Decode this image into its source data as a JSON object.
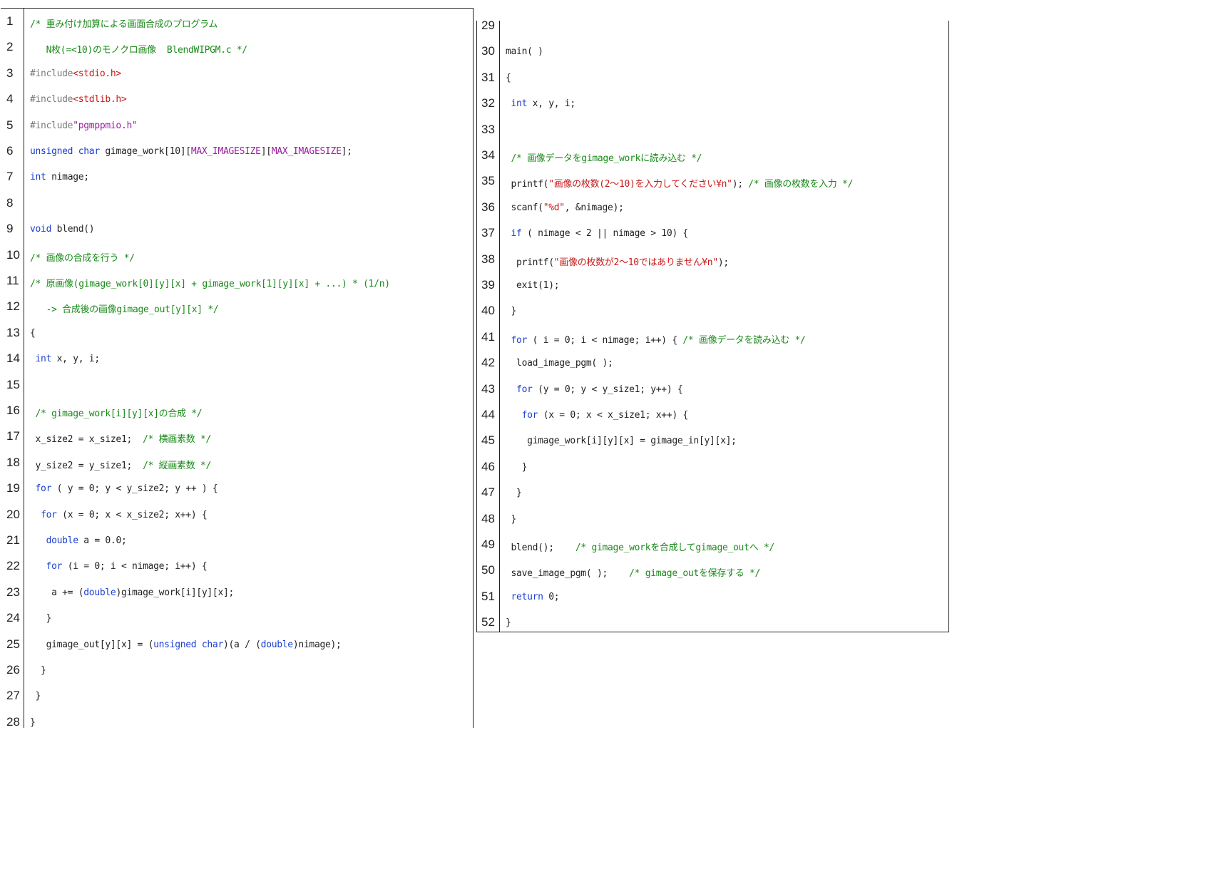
{
  "colors": {
    "keyword": "#1a3fd0",
    "comment": "#1a8a1a",
    "string": "#c81a1a",
    "macro": "#9a1ea0",
    "preprocessor": "#7a7a7a",
    "plain": "#222222"
  },
  "left_lines": [
    {
      "n": "1",
      "tokens": [
        {
          "t": "cm",
          "v": "/* 重み付け加算による画面合成のプログラム"
        }
      ]
    },
    {
      "n": "2",
      "tokens": [
        {
          "t": "cm",
          "v": "   N枚(=<10)のモノクロ画像  BlendWIPGM.c */"
        }
      ]
    },
    {
      "n": "3",
      "tokens": [
        {
          "t": "pp",
          "v": "#include"
        },
        {
          "t": "str",
          "v": "<stdio.h>"
        }
      ]
    },
    {
      "n": "4",
      "tokens": [
        {
          "t": "pp",
          "v": "#include"
        },
        {
          "t": "str",
          "v": "<stdlib.h>"
        }
      ]
    },
    {
      "n": "5",
      "tokens": [
        {
          "t": "pp",
          "v": "#include"
        },
        {
          "t": "mac",
          "v": "\"pgmppmio.h\""
        }
      ]
    },
    {
      "n": "6",
      "tokens": [
        {
          "t": "kw",
          "v": "unsigned char"
        },
        {
          "t": "pl",
          "v": " gimage_work[10]["
        },
        {
          "t": "mac",
          "v": "MAX_IMAGESIZE"
        },
        {
          "t": "pl",
          "v": "]["
        },
        {
          "t": "mac",
          "v": "MAX_IMAGESIZE"
        },
        {
          "t": "pl",
          "v": "];"
        }
      ]
    },
    {
      "n": "7",
      "tokens": [
        {
          "t": "kw",
          "v": "int"
        },
        {
          "t": "pl",
          "v": " nimage;"
        }
      ]
    },
    {
      "n": "8",
      "tokens": []
    },
    {
      "n": "9",
      "tokens": [
        {
          "t": "kw",
          "v": "void"
        },
        {
          "t": "pl",
          "v": " blend()"
        }
      ]
    },
    {
      "n": "10",
      "tokens": [
        {
          "t": "cm",
          "v": "/* 画像の合成を行う */"
        }
      ]
    },
    {
      "n": "11",
      "tokens": [
        {
          "t": "cm",
          "v": "/* 原画像(gimage_work[0][y][x] + gimage_work[1][y][x] + ...) * (1/n)"
        }
      ]
    },
    {
      "n": "12",
      "tokens": [
        {
          "t": "cm",
          "v": "   -> 合成後の画像gimage_out[y][x] */"
        }
      ]
    },
    {
      "n": "13",
      "tokens": [
        {
          "t": "pl",
          "v": "{"
        }
      ]
    },
    {
      "n": "14",
      "tokens": [
        {
          "t": "pl",
          "v": " "
        },
        {
          "t": "kw",
          "v": "int"
        },
        {
          "t": "pl",
          "v": " x, y, i;"
        }
      ]
    },
    {
      "n": "15",
      "tokens": []
    },
    {
      "n": "16",
      "tokens": [
        {
          "t": "pl",
          "v": " "
        },
        {
          "t": "cm",
          "v": "/* gimage_work[i][y][x]の合成 */"
        }
      ]
    },
    {
      "n": "17",
      "tokens": [
        {
          "t": "pl",
          "v": " x_size2 = x_size1;  "
        },
        {
          "t": "cm",
          "v": "/* 横画素数 */"
        }
      ]
    },
    {
      "n": "18",
      "tokens": [
        {
          "t": "pl",
          "v": " y_size2 = y_size1;  "
        },
        {
          "t": "cm",
          "v": "/* 縦画素数 */"
        }
      ]
    },
    {
      "n": "19",
      "tokens": [
        {
          "t": "pl",
          "v": " "
        },
        {
          "t": "kw",
          "v": "for"
        },
        {
          "t": "pl",
          "v": " ( y = 0; y < y_size2; y ++ ) {"
        }
      ]
    },
    {
      "n": "20",
      "tokens": [
        {
          "t": "pl",
          "v": "  "
        },
        {
          "t": "kw",
          "v": "for"
        },
        {
          "t": "pl",
          "v": " (x = 0; x < x_size2; x++) {"
        }
      ]
    },
    {
      "n": "21",
      "tokens": [
        {
          "t": "pl",
          "v": "   "
        },
        {
          "t": "kw",
          "v": "double"
        },
        {
          "t": "pl",
          "v": " a = 0.0;"
        }
      ]
    },
    {
      "n": "22",
      "tokens": [
        {
          "t": "pl",
          "v": "   "
        },
        {
          "t": "kw",
          "v": "for"
        },
        {
          "t": "pl",
          "v": " (i = 0; i < nimage; i++) {"
        }
      ]
    },
    {
      "n": "23",
      "tokens": [
        {
          "t": "pl",
          "v": "    a += ("
        },
        {
          "t": "kw",
          "v": "double"
        },
        {
          "t": "pl",
          "v": ")gimage_work[i][y][x];"
        }
      ]
    },
    {
      "n": "24",
      "tokens": [
        {
          "t": "pl",
          "v": "   }"
        }
      ]
    },
    {
      "n": "25",
      "tokens": [
        {
          "t": "pl",
          "v": "   gimage_out[y][x] = ("
        },
        {
          "t": "kw",
          "v": "unsigned char"
        },
        {
          "t": "pl",
          "v": ")(a / ("
        },
        {
          "t": "kw",
          "v": "double"
        },
        {
          "t": "pl",
          "v": ")nimage);"
        }
      ]
    },
    {
      "n": "26",
      "tokens": [
        {
          "t": "pl",
          "v": "  }"
        }
      ]
    },
    {
      "n": "27",
      "tokens": [
        {
          "t": "pl",
          "v": " }"
        }
      ]
    },
    {
      "n": "28",
      "tokens": [
        {
          "t": "pl",
          "v": "}"
        }
      ]
    }
  ],
  "right_lines": [
    {
      "n": "29",
      "tokens": []
    },
    {
      "n": "30",
      "tokens": [
        {
          "t": "pl",
          "v": "main( )"
        }
      ]
    },
    {
      "n": "31",
      "tokens": [
        {
          "t": "pl",
          "v": "{"
        }
      ]
    },
    {
      "n": "32",
      "tokens": [
        {
          "t": "pl",
          "v": " "
        },
        {
          "t": "kw",
          "v": "int"
        },
        {
          "t": "pl",
          "v": " x, y, i;"
        }
      ]
    },
    {
      "n": "33",
      "tokens": []
    },
    {
      "n": "34",
      "tokens": [
        {
          "t": "pl",
          "v": " "
        },
        {
          "t": "cm",
          "v": "/* 画像データをgimage_workに読み込む */"
        }
      ]
    },
    {
      "n": "35",
      "tokens": [
        {
          "t": "pl",
          "v": " printf("
        },
        {
          "t": "str",
          "v": "\"画像の枚数(2～10)を入力してください¥n\""
        },
        {
          "t": "pl",
          "v": "); "
        },
        {
          "t": "cm",
          "v": "/* 画像の枚数を入力 */"
        }
      ]
    },
    {
      "n": "36",
      "tokens": [
        {
          "t": "pl",
          "v": " scanf("
        },
        {
          "t": "str",
          "v": "\"%d\""
        },
        {
          "t": "pl",
          "v": ", &nimage);"
        }
      ]
    },
    {
      "n": "37",
      "tokens": [
        {
          "t": "pl",
          "v": " "
        },
        {
          "t": "kw",
          "v": "if"
        },
        {
          "t": "pl",
          "v": " ( nimage < 2 || nimage > 10) {"
        }
      ]
    },
    {
      "n": "38",
      "tokens": [
        {
          "t": "pl",
          "v": "  printf("
        },
        {
          "t": "str",
          "v": "\"画像の枚数が2～10ではありません¥n\""
        },
        {
          "t": "pl",
          "v": ");"
        }
      ]
    },
    {
      "n": "39",
      "tokens": [
        {
          "t": "pl",
          "v": "  exit(1);"
        }
      ]
    },
    {
      "n": "40",
      "tokens": [
        {
          "t": "pl",
          "v": " }"
        }
      ]
    },
    {
      "n": "41",
      "tokens": [
        {
          "t": "pl",
          "v": " "
        },
        {
          "t": "kw",
          "v": "for"
        },
        {
          "t": "pl",
          "v": " ( i = 0; i < nimage; i++) { "
        },
        {
          "t": "cm",
          "v": "/* 画像データを読み込む */"
        }
      ]
    },
    {
      "n": "42",
      "tokens": [
        {
          "t": "pl",
          "v": "  load_image_pgm( );"
        }
      ]
    },
    {
      "n": "43",
      "tokens": [
        {
          "t": "pl",
          "v": "  "
        },
        {
          "t": "kw",
          "v": "for"
        },
        {
          "t": "pl",
          "v": " (y = 0; y < y_size1; y++) {"
        }
      ]
    },
    {
      "n": "44",
      "tokens": [
        {
          "t": "pl",
          "v": "   "
        },
        {
          "t": "kw",
          "v": "for"
        },
        {
          "t": "pl",
          "v": " (x = 0; x < x_size1; x++) {"
        }
      ]
    },
    {
      "n": "45",
      "tokens": [
        {
          "t": "pl",
          "v": "    gimage_work[i][y][x] = gimage_in[y][x];"
        }
      ]
    },
    {
      "n": "46",
      "tokens": [
        {
          "t": "pl",
          "v": "   }"
        }
      ]
    },
    {
      "n": "47",
      "tokens": [
        {
          "t": "pl",
          "v": "  }"
        }
      ]
    },
    {
      "n": "48",
      "tokens": [
        {
          "t": "pl",
          "v": " }"
        }
      ]
    },
    {
      "n": "49",
      "tokens": [
        {
          "t": "pl",
          "v": " blend();    "
        },
        {
          "t": "cm",
          "v": "/* gimage_workを合成してgimage_outへ */"
        }
      ]
    },
    {
      "n": "50",
      "tokens": [
        {
          "t": "pl",
          "v": " save_image_pgm( );    "
        },
        {
          "t": "cm",
          "v": "/* gimage_outを保存する */"
        }
      ]
    },
    {
      "n": "51",
      "tokens": [
        {
          "t": "pl",
          "v": " "
        },
        {
          "t": "kw",
          "v": "return"
        },
        {
          "t": "pl",
          "v": " 0;"
        }
      ]
    },
    {
      "n": "52",
      "tokens": [
        {
          "t": "pl",
          "v": "}"
        }
      ]
    }
  ]
}
